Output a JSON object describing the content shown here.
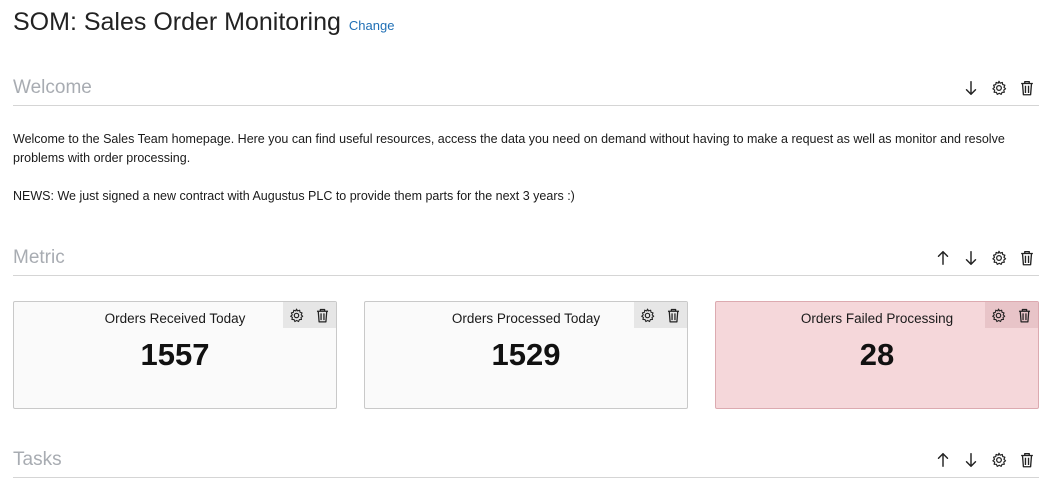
{
  "page": {
    "title": "SOM: Sales Order Monitoring",
    "change_link": "Change"
  },
  "sections": {
    "welcome": {
      "title": "Welcome",
      "paragraphs": [
        "Welcome to the Sales Team homepage. Here you can find useful resources, access the data you need on demand without having to make a request as well as monitor and resolve problems with order processing.",
        "NEWS: We just signed a new contract with Augustus PLC to provide them parts for the next 3 years :)"
      ]
    },
    "metric": {
      "title": "Metric",
      "cards": [
        {
          "label": "Orders Received Today",
          "value": "1557",
          "status": "normal"
        },
        {
          "label": "Orders Processed Today",
          "value": "1529",
          "status": "normal"
        },
        {
          "label": "Orders Failed Processing",
          "value": "28",
          "status": "alert"
        }
      ]
    },
    "tasks": {
      "title": "Tasks"
    }
  },
  "icons": {
    "move_up": "arrow-up-icon",
    "move_down": "arrow-down-icon",
    "settings": "gear-icon",
    "delete": "trash-icon"
  },
  "colors": {
    "link": "#1f6fb5",
    "section_title": "#a8acb2",
    "alert_card_bg": "#f5d7da",
    "card_bg": "#fafafa"
  }
}
